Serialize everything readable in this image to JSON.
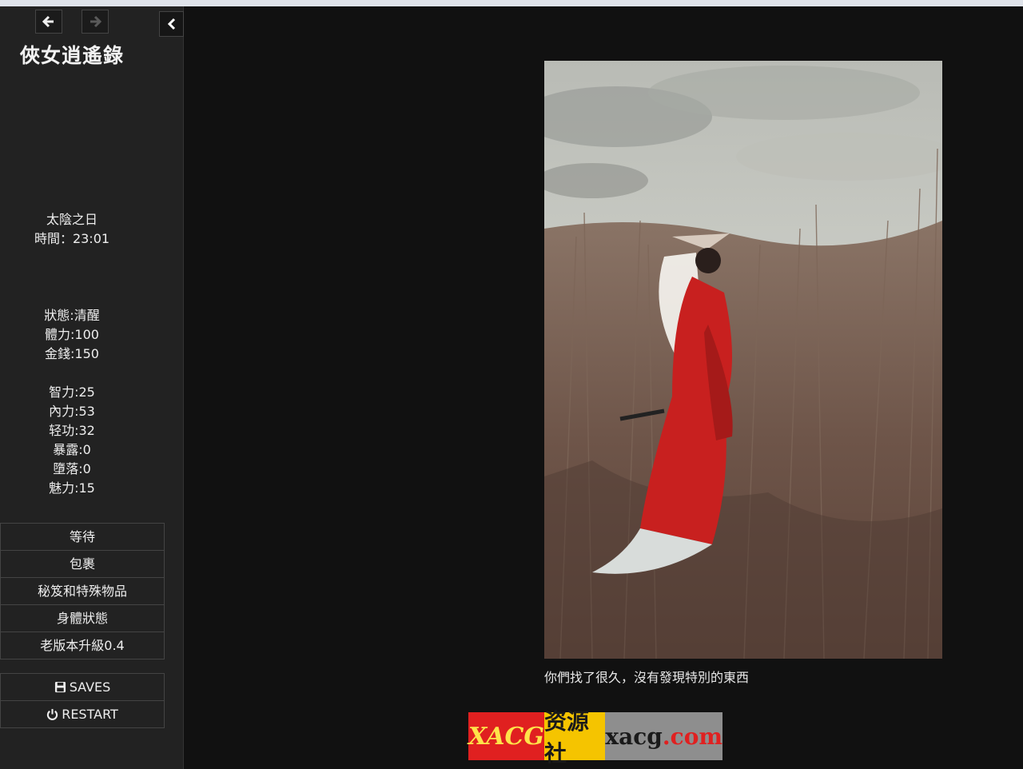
{
  "sidebar": {
    "title": "俠女逍遙錄",
    "caption": [
      "太陰之日",
      "時間：23:01"
    ],
    "stats1": [
      "狀態:清醒",
      "體力:100",
      "金錢:150"
    ],
    "stats2": [
      "智力:25",
      "內力:53",
      "轻功:32",
      "暴露:0",
      "墮落:0",
      "魅力:15"
    ],
    "menu": [
      "等待",
      "包裹",
      "秘笈和特殊物品",
      "身體狀態",
      "老版本升級0.4"
    ],
    "saves_label": "SAVES",
    "restart_label": "RESTART"
  },
  "passage": {
    "text": "你們找了很久，沒有發現特別的東西"
  },
  "watermark": {
    "part1": "XACG",
    "part2": "资源社",
    "part3": "xacg",
    "part4": ".com"
  },
  "colors": {
    "background": "#111111",
    "sidebar": "#222222",
    "dress": "#c8201f"
  },
  "icons": {
    "back": "arrow-left-icon",
    "forward": "arrow-right-icon",
    "collapse": "chevron-left-icon",
    "saves": "floppy-disk-icon",
    "restart": "power-icon"
  }
}
